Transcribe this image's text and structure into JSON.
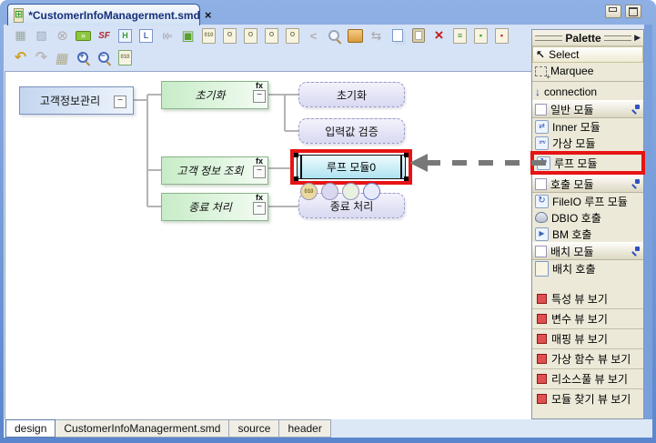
{
  "window": {
    "tab": {
      "icon_glyph": "⊞",
      "title": "*CustomerInfoManagerment.smd",
      "close_glyph": "×"
    }
  },
  "toolbar": {
    "row1": [
      {
        "name": "add-module",
        "glyph": "▦"
      },
      {
        "name": "export-module",
        "glyph": "▧"
      },
      {
        "name": "disconnect",
        "glyph": "⊗"
      },
      {
        "name": "collapse-range",
        "glyph": "»"
      },
      {
        "name": "script-function",
        "glyph": "SF"
      },
      {
        "name": "frame-module",
        "glyph": "H"
      },
      {
        "name": "hierarchy",
        "glyph": "L"
      },
      {
        "name": "expression",
        "glyph": "(x)="
      },
      {
        "name": "inner-module",
        "glyph": "▣"
      },
      {
        "name": "binary-doc",
        "glyph": "010"
      },
      {
        "name": "copy-doc-1",
        "glyph": "O"
      },
      {
        "name": "copy-doc-2",
        "glyph": "O"
      },
      {
        "name": "copy-doc-3",
        "glyph": "O"
      },
      {
        "name": "copy-doc-4",
        "glyph": "O"
      },
      {
        "name": "collapse-left",
        "glyph": "<"
      },
      {
        "name": "refresh",
        "glyph": "⇆"
      },
      {
        "name": "delete",
        "glyph": "×"
      },
      {
        "name": "checklist",
        "glyph": "≡"
      },
      {
        "name": "bookmark-green",
        "glyph": "▪"
      },
      {
        "name": "bookmark-red",
        "glyph": "▪"
      }
    ],
    "row2": [
      {
        "name": "undo",
        "glyph": "↶"
      },
      {
        "name": "redo",
        "glyph": "↷"
      },
      {
        "name": "table-view",
        "glyph": "▦"
      },
      {
        "name": "zoom-in",
        "glyph": "+"
      },
      {
        "name": "zoom-out",
        "glyph": "−"
      },
      {
        "name": "binary-doc",
        "glyph": "010"
      }
    ]
  },
  "canvas": {
    "root": {
      "label": "고객정보관리",
      "collapse_glyph": "−"
    },
    "functions": [
      {
        "label": "초기화",
        "badge": "fx",
        "collapse_glyph": "−"
      },
      {
        "label": "고객 정보 조회",
        "badge": "fx",
        "collapse_glyph": "−"
      },
      {
        "label": "종료 처리",
        "badge": "fx",
        "collapse_glyph": "−"
      }
    ],
    "modules": [
      {
        "label": "초기화"
      },
      {
        "label": "입력값 검증"
      },
      {
        "label": "루프 모듈0"
      },
      {
        "label": "종료 처리"
      }
    ],
    "quickbar": {
      "binary_glyph": "010"
    }
  },
  "palette": {
    "title": "Palette",
    "header_arrow": "▶",
    "select": "Select",
    "marquee": "Marquee",
    "connection": "connection",
    "drawer_general": "일반 모듈",
    "item_inner": "Inner 모듈",
    "item_virtual": "가상 모듈",
    "item_loop": "루프 모듈",
    "drawer_call": "호출 모듈",
    "item_fileio": "FileIO 루프 모듈",
    "item_dbio": "DBIO 호출",
    "item_bm": "BM 호출",
    "drawer_batch": "배치 모듈",
    "item_batch_call": "배치 호출",
    "view_items": [
      "특성 뷰 보기",
      "변수 뷰 보기",
      "매핑 뷰 보기",
      "가상 함수 뷰 보기",
      "리소스풀 뷰 보기",
      "모듈 찾기 뷰 보기"
    ],
    "icons": {
      "select_glyph": "↖",
      "connection_glyph": "↓",
      "loop_glyph": "↻",
      "bm_glyph": "▶",
      "inner_glyph": "⇄",
      "virtual_glyph": "x+v"
    }
  },
  "bottom_tabs": [
    "design",
    "CustomerInfoManagerment.smd",
    "source",
    "header"
  ],
  "colors": {
    "highlight_red": "#e61414",
    "arrow_gray": "#787878",
    "node_cyan": "#bfeaf4",
    "node_green": "#d9f2d9",
    "node_lavender": "#e4e4f8",
    "node_blue": "#ccdcf2",
    "palette_bg": "#ece9d8"
  }
}
